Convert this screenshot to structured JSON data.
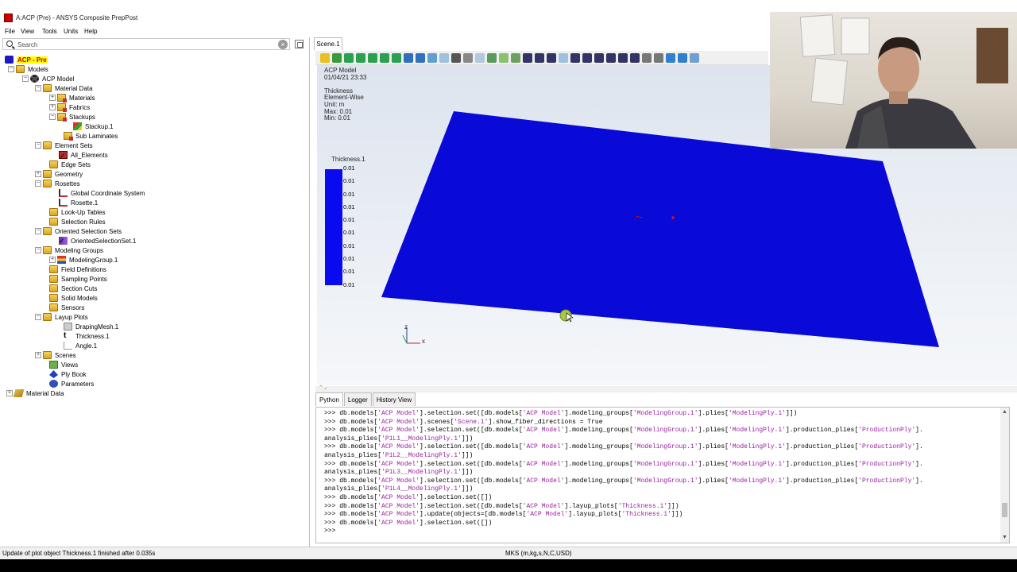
{
  "window": {
    "title": "A:ACP (Pre) - ANSYS Composite PrepPost"
  },
  "menu": [
    "File",
    "View",
    "Tools",
    "Units",
    "Help"
  ],
  "search": {
    "placeholder": "Search"
  },
  "tree": [
    {
      "label": "ACP - Pre",
      "icon": "db-icon",
      "highlight": true
    },
    {
      "label": "Models",
      "icon": "folder-icon"
    },
    {
      "label": "ACP Model",
      "icon": "gear-icon"
    },
    {
      "label": "Material Data",
      "icon": "folder-icon"
    },
    {
      "label": "Materials",
      "icon": "folder-icon"
    },
    {
      "label": "Fabrics",
      "icon": "folder-icon"
    },
    {
      "label": "Stackups",
      "icon": "folder-icon"
    },
    {
      "label": "Stackup.1",
      "icon": "stack-icon"
    },
    {
      "label": "Sub Laminates",
      "icon": "folder-icon"
    },
    {
      "label": "Element Sets",
      "icon": "folder-icon"
    },
    {
      "label": "All_Elements",
      "icon": "element-set-icon"
    },
    {
      "label": "Edge Sets",
      "icon": "folder-icon"
    },
    {
      "label": "Geometry",
      "icon": "folder-icon"
    },
    {
      "label": "Rosettes",
      "icon": "folder-icon"
    },
    {
      "label": "Global Coordinate System",
      "icon": "axis-icon"
    },
    {
      "label": "Rosette.1",
      "icon": "axis-icon"
    },
    {
      "label": "Look-Up Tables",
      "icon": "folder-icon"
    },
    {
      "label": "Selection Rules",
      "icon": "folder-icon"
    },
    {
      "label": "Oriented Selection Sets",
      "icon": "folder-icon"
    },
    {
      "label": "OrientedSelectionSet.1",
      "icon": "oss-icon"
    },
    {
      "label": "Modeling Groups",
      "icon": "folder-icon"
    },
    {
      "label": "ModelingGroup.1",
      "icon": "layers-icon"
    },
    {
      "label": "Field Definitions",
      "icon": "folder-icon"
    },
    {
      "label": "Sampling Points",
      "icon": "folder-icon"
    },
    {
      "label": "Section Cuts",
      "icon": "folder-icon"
    },
    {
      "label": "Solid Models",
      "icon": "folder-icon"
    },
    {
      "label": "Sensors",
      "icon": "folder-icon"
    },
    {
      "label": "Layup Plots",
      "icon": "folder-icon"
    },
    {
      "label": "DrapingMesh.1",
      "icon": "mesh-icon"
    },
    {
      "label": "Thickness.1",
      "icon": "thickness-icon"
    },
    {
      "label": "Angle.1",
      "icon": "angle-icon"
    },
    {
      "label": "Scenes",
      "icon": "folder-icon"
    },
    {
      "label": "Views",
      "icon": "view-icon"
    },
    {
      "label": "Ply Book",
      "icon": "ply-book-icon"
    },
    {
      "label": "Parameters",
      "icon": "parameters-icon"
    },
    {
      "label": "Material Data",
      "icon": "material-data-icon"
    }
  ],
  "scene": {
    "tab": "Scene.1",
    "info": [
      "ACP Model",
      "01/04/21 23:33",
      "",
      "Thickness",
      "Element-Wise",
      "Unit: m",
      "Max: 0.01",
      "Min: 0.01"
    ],
    "legend_title": "Thickness.1",
    "legend_values": [
      "0.01",
      "0.01",
      "0.01",
      "0.01",
      "0.01",
      "0.01",
      "0.01",
      "0.01",
      "0.01",
      "0.01"
    ],
    "plate_color": "#0a0ad8",
    "axis_labels": {
      "z": "z",
      "x": "x"
    }
  },
  "console": {
    "tabs": [
      "Python",
      "Logger",
      "History View"
    ],
    "lines": [
      [
        ">>> db.models[",
        "'ACP Model'",
        "].selection.set([db.models[",
        "'ACP Model'",
        "].modeling_groups[",
        "'ModelingGroup.1'",
        "].plies[",
        "'ModelingPly.1'",
        "]])"
      ],
      [
        ">>> db.models[",
        "'ACP Model'",
        "].scenes[",
        "'Scene.1'",
        "].show_fiber_directions = True"
      ],
      [
        ">>> db.models[",
        "'ACP Model'",
        "].selection.set([db.models[",
        "'ACP Model'",
        "].modeling_groups[",
        "'ModelingGroup.1'",
        "].plies[",
        "'ModelingPly.1'",
        "].production_plies[",
        "'ProductionPly'",
        "]."
      ],
      [
        "analysis_plies[",
        "'P1L1__ModelingPly.1'",
        "]])"
      ],
      [
        ">>> db.models[",
        "'ACP Model'",
        "].selection.set([db.models[",
        "'ACP Model'",
        "].modeling_groups[",
        "'ModelingGroup.1'",
        "].plies[",
        "'ModelingPly.1'",
        "].production_plies[",
        "'ProductionPly'",
        "]."
      ],
      [
        "analysis_plies[",
        "'P1L2__ModelingPly.1'",
        "]])"
      ],
      [
        ">>> db.models[",
        "'ACP Model'",
        "].selection.set([db.models[",
        "'ACP Model'",
        "].modeling_groups[",
        "'ModelingGroup.1'",
        "].plies[",
        "'ModelingPly.1'",
        "].production_plies[",
        "'ProductionPly'",
        "]."
      ],
      [
        "analysis_plies[",
        "'P1L3__ModelingPly.1'",
        "]])"
      ],
      [
        ">>> db.models[",
        "'ACP Model'",
        "].selection.set([db.models[",
        "'ACP Model'",
        "].modeling_groups[",
        "'ModelingGroup.1'",
        "].plies[",
        "'ModelingPly.1'",
        "].production_plies[",
        "'ProductionPly'",
        "]."
      ],
      [
        "analysis_plies[",
        "'P1L4__ModelingPly.1'",
        "]])"
      ],
      [
        ">>> db.models[",
        "'ACP Model'",
        "].selection.set([])"
      ],
      [
        ">>> db.models[",
        "'ACP Model'",
        "].selection.set([db.models[",
        "'ACP Model'",
        "].layup_plots[",
        "'Thickness.1'",
        "]])"
      ],
      [
        ">>> db.models[",
        "'ACP Model'",
        "].update(objects=[db.models[",
        "'ACP Model'",
        "].layup_plots[",
        "'Thickness.1'",
        "]])"
      ],
      [
        ">>> db.models[",
        "'ACP Model'",
        "].selection.set([])"
      ],
      [
        ">>> "
      ]
    ]
  },
  "status": {
    "left": "Update of plot object Thickness.1 finished after 0.035s",
    "center": "MKS (m,kg,s,N,C,USD)"
  }
}
